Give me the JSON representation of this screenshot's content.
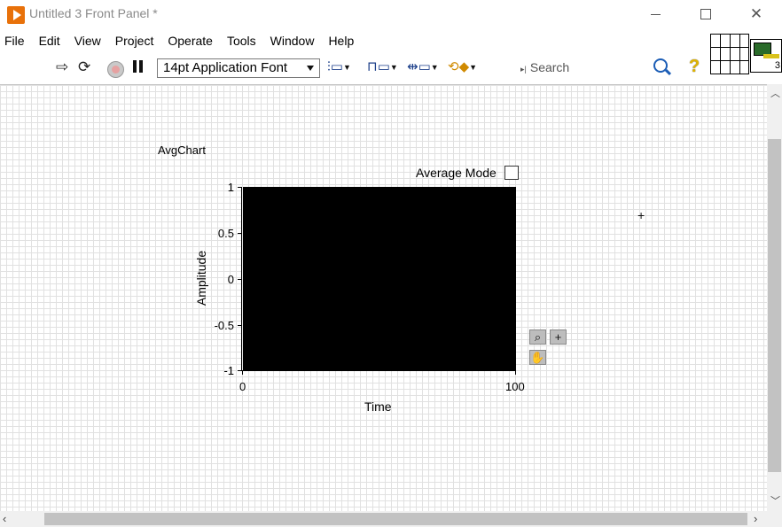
{
  "window": {
    "title": "Untitled 3 Front Panel *",
    "minimize": "—",
    "maximize": "☐",
    "close": "✕"
  },
  "menu": [
    "File",
    "Edit",
    "View",
    "Project",
    "Operate",
    "Tools",
    "Window",
    "Help"
  ],
  "toolbar": {
    "font_label": "14pt Application Font",
    "search_placeholder": "Search",
    "help_glyph": "?"
  },
  "vi_icon": {
    "number": "3"
  },
  "chart": {
    "label": "AvgChart",
    "average_mode_label": "Average Mode",
    "average_mode_checked": false,
    "y_title": "Amplitude",
    "x_title": "Time",
    "y_ticks": [
      "1",
      "0.5",
      "0",
      "-0.5",
      "-1"
    ],
    "x_ticks": [
      "0",
      "100"
    ],
    "plot_background": "#000000",
    "palette": {
      "zoom_glyph": "⌕",
      "cursor_glyph": "+",
      "pan_glyph": "✋"
    }
  },
  "chart_data": {
    "type": "line",
    "title": "AvgChart",
    "xlabel": "Time",
    "ylabel": "Amplitude",
    "xlim": [
      0,
      100
    ],
    "ylim": [
      -1,
      1
    ],
    "x_ticks": [
      0,
      100
    ],
    "y_ticks": [
      1,
      0.5,
      0,
      -0.5,
      -1
    ],
    "series": []
  }
}
